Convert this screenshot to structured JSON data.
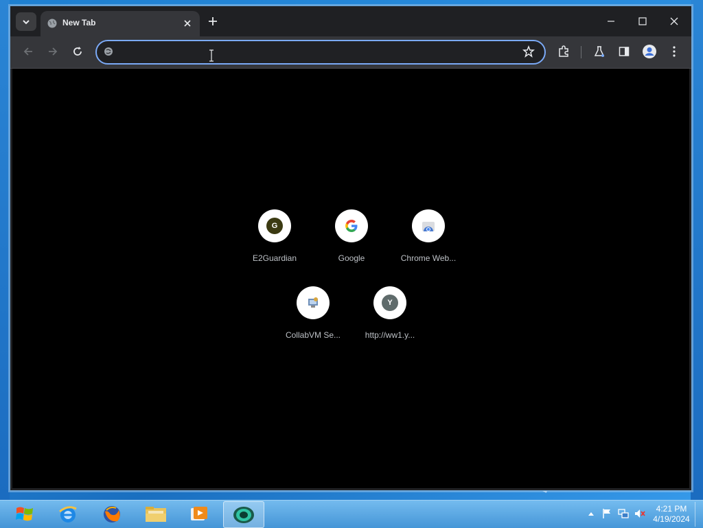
{
  "browser": {
    "tab": {
      "title": "New Tab"
    },
    "omnibox": {
      "value": "",
      "placeholder": ""
    }
  },
  "shortcuts": [
    {
      "label": "E2Guardian",
      "icon": "letter",
      "letter": "G",
      "color": "#3b3a12"
    },
    {
      "label": "Google",
      "icon": "google-icon"
    },
    {
      "label": "Chrome Web...",
      "icon": "chrome-web-store-icon"
    },
    {
      "label": "CollabVM Se...",
      "icon": "collabvm-icon"
    },
    {
      "label": "http://ww1.y...",
      "icon": "letter",
      "letter": "Y",
      "color": "#5f6b6b"
    }
  ],
  "taskbar": {
    "clock": {
      "time": "4:21 PM",
      "date": "4/19/2024"
    }
  },
  "colors": {
    "accent": "#7baaf7",
    "tab_bg": "#35363a",
    "titlebar_bg": "#1f2023",
    "content_bg": "#000000"
  }
}
